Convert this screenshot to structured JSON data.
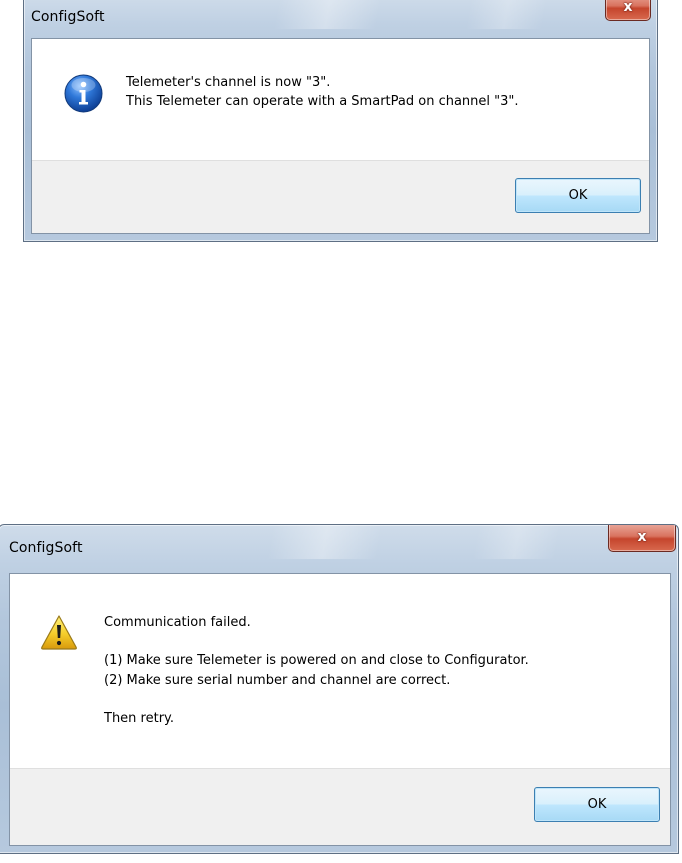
{
  "dialog_info": {
    "title": "ConfigSoft",
    "close_glyph": "x",
    "icon": "information-icon",
    "message_lines": [
      "Telemeter's channel is now \"3\".",
      "This Telemeter can operate with a SmartPad on channel \"3\"."
    ],
    "ok_label": "OK"
  },
  "dialog_warning": {
    "title": "ConfigSoft",
    "close_glyph": "x",
    "icon": "warning-icon",
    "message_lines": [
      "Communication failed.",
      "(1) Make sure Telemeter is powered on and close to Configurator.",
      "(2) Make sure serial number and channel are correct.",
      "Then retry."
    ],
    "ok_label": "OK"
  },
  "colors": {
    "info_icon_blue": "#1f62c5",
    "warning_icon_yellow": "#f5cc2a",
    "button_area": "#f0f0f0",
    "close_button_red": "#c5452d"
  }
}
